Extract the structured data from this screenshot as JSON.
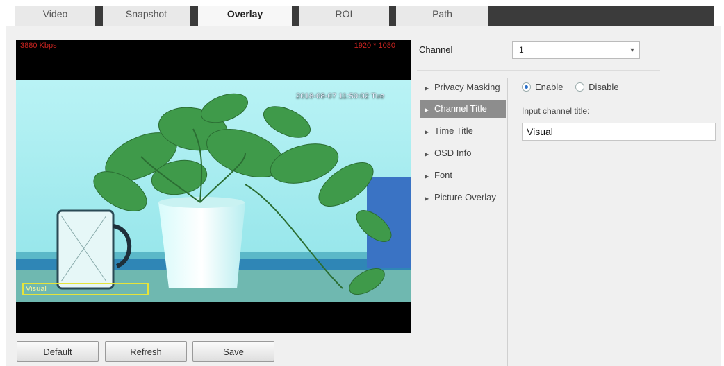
{
  "tabs": [
    {
      "label": "Video"
    },
    {
      "label": "Snapshot"
    },
    {
      "label": "Overlay",
      "active": true
    },
    {
      "label": "ROI"
    },
    {
      "label": "Path"
    }
  ],
  "preview": {
    "bitrate": "3880 Kbps",
    "resolution": "1920 * 1080",
    "osd_time": "2018-08-07 11:50:02 Tue",
    "osd_channel_title": "Visual"
  },
  "channel": {
    "label": "Channel",
    "value": "1"
  },
  "menu": [
    {
      "label": "Privacy Masking"
    },
    {
      "label": "Channel Title",
      "active": true
    },
    {
      "label": "Time Title"
    },
    {
      "label": "OSD Info"
    },
    {
      "label": "Font"
    },
    {
      "label": "Picture Overlay"
    }
  ],
  "channel_title": {
    "enable_label": "Enable",
    "disable_label": "Disable",
    "enabled": true,
    "input_label": "Input channel title:",
    "input_value": "Visual"
  },
  "buttons": {
    "default": "Default",
    "refresh": "Refresh",
    "save": "Save"
  },
  "colors": {
    "tab_bar": "#3b3b3b",
    "active_menu": "#8d8d8d",
    "osd_text": "#c8231f",
    "osd_box": "#e6e43a"
  }
}
